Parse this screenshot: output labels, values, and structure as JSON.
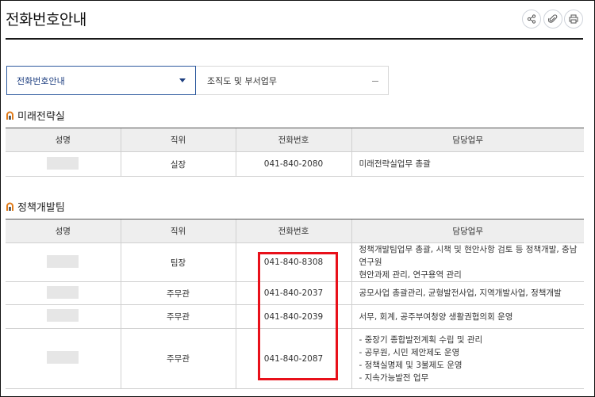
{
  "page": {
    "title": "전화번호안내"
  },
  "toolbar": {
    "share_icon": "share-icon",
    "attach_icon": "paperclip-icon",
    "print_icon": "print-icon"
  },
  "nav": {
    "selector_value": "전화번호안내",
    "link_label": "조직도 및 부서업무"
  },
  "sections": [
    {
      "title": "미래전략실",
      "headers": [
        "성명",
        "직위",
        "전화번호",
        "담당업무"
      ],
      "rows": [
        {
          "position": "실장",
          "phone": "041-840-2080",
          "duty": "미래전략실업무 총괄"
        }
      ]
    },
    {
      "title": "정책개발팀",
      "headers": [
        "성명",
        "직위",
        "전화번호",
        "담당업무"
      ],
      "rows": [
        {
          "position": "팀장",
          "phone": "041-840-8308",
          "duty_lines": [
            "정책개발팀업무 총괄, 시책 및 현안사항 검토 등 정책개발, 충남연구원",
            "현안과제 관리, 연구용역 관리"
          ]
        },
        {
          "position": "주무관",
          "phone": "041-840-2037",
          "duty": "공모사업 총괄관리, 균형발전사업, 지역개발사업, 정책개발"
        },
        {
          "position": "주무관",
          "phone": "041-840-2039",
          "duty": "서무, 회계, 공주부여청양 생활권협의회 운영"
        },
        {
          "position": "주무관",
          "phone": "041-840-2087",
          "duty_lines": [
            "- 중장기 종합발전계획 수립 및 관리",
            "- 공무원, 시민 제안제도 운영",
            "- 정책실명제 및 3불제도 운영",
            "- 지속가능발전 업무"
          ]
        }
      ]
    }
  ],
  "colors": {
    "accent": "#1e3f80",
    "highlight": "#e8101a",
    "header_bg": "#eeeeee"
  }
}
